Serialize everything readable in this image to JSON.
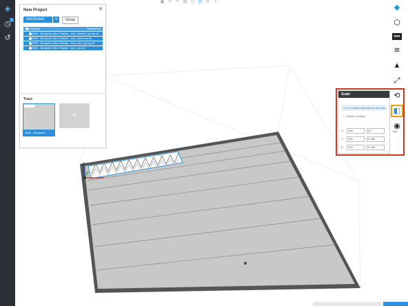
{
  "toolbar_top": {
    "icons": [
      "open-file-icon",
      "undo-icon",
      "redo-icon",
      "paste-icon",
      "cube-view-icon",
      "ortho-view-icon",
      "refresh-icon",
      "help-icon"
    ]
  },
  "leftbar": {
    "icons": [
      "logo-icon",
      "history-clock-icon",
      "recent-icon"
    ],
    "badge": "1"
  },
  "project": {
    "title": "New Project",
    "add_models_label": "Add Models",
    "group_label": "Group",
    "tree": {
      "assembly": {
        "label": "Assembly",
        "status": "Assembled"
      },
      "models": [
        "2695 - Benjamin Allen Stutzke - test_blended_group.stl",
        "2695 - Benjamin Allen Stutzke - test_chevrons.stl",
        "2695 - Benjamin Allen Stutzke - test_hard_group.stl",
        "2695 - Benjamin Allen Stutzke - test_skin.stl"
      ]
    },
    "trays_label": "Trays",
    "tray1_caption": "2695 - Benjamin ...",
    "add_tray_symbol": "+"
  },
  "scale": {
    "title": "Scale",
    "note": "1 of 1 models selected on this tray",
    "uniform_label": "Uniform Scaling",
    "col_percent": "%",
    "col_units": "in",
    "rows": [
      {
        "axis": "X:",
        "percent": "100",
        "value": "8.7"
      },
      {
        "axis": "Y:",
        "percent": "100",
        "value": "2.156"
      },
      {
        "axis": "Z:",
        "percent": "100",
        "value": "0.246"
      }
    ]
  },
  "righttools": {
    "mm_label": "mm",
    "support_label": "SUP"
  },
  "axis_labels": {
    "z": "Z"
  },
  "colors": {
    "accent": "#2d8fd8",
    "highlight_red": "#c0392b",
    "highlight_orange": "#f39c12",
    "platform": "#c8c8c8",
    "platform_border": "#555555"
  }
}
